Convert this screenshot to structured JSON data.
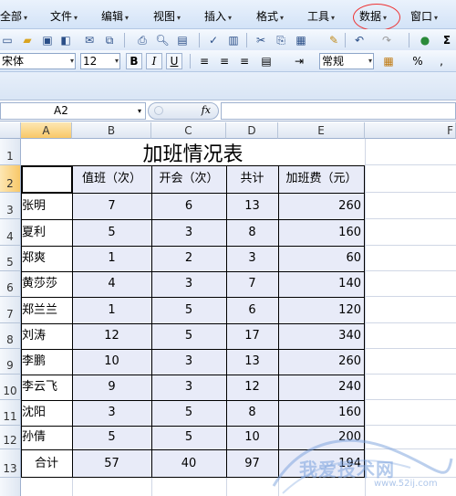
{
  "menu": {
    "items": [
      "全部",
      "文件",
      "编辑",
      "视图",
      "插入",
      "格式",
      "工具",
      "数据",
      "窗口"
    ]
  },
  "toolbar": {
    "font_name": "宋体",
    "font_size": "12",
    "bold_label": "B",
    "italic_label": "I",
    "underline_label": "U",
    "number_format": "常规",
    "percent_label": "%",
    "sigma_label": "Σ"
  },
  "formula_bar": {
    "name_box": "A2",
    "fx_label": "fx",
    "content": ""
  },
  "sheet": {
    "columns": [
      "A",
      "B",
      "C",
      "D",
      "E",
      "F"
    ],
    "rows": [
      "1",
      "2",
      "3",
      "4",
      "5",
      "6",
      "7",
      "8",
      "9",
      "10",
      "11",
      "12",
      "13"
    ],
    "selected_cell": "A2",
    "title": "加班情况表",
    "headers": [
      "",
      "值班（次）",
      "开会（次）",
      "共计",
      "加班费（元）"
    ],
    "data": [
      {
        "name": "张明",
        "duty": "7",
        "meeting": "6",
        "total": "13",
        "pay": "260"
      },
      {
        "name": "夏利",
        "duty": "5",
        "meeting": "3",
        "total": "8",
        "pay": "160"
      },
      {
        "name": "郑爽",
        "duty": "1",
        "meeting": "2",
        "total": "3",
        "pay": "60"
      },
      {
        "name": "黄莎莎",
        "duty": "4",
        "meeting": "3",
        "total": "7",
        "pay": "140"
      },
      {
        "name": "郑兰兰",
        "duty": "1",
        "meeting": "5",
        "total": "6",
        "pay": "120"
      },
      {
        "name": "刘涛",
        "duty": "12",
        "meeting": "5",
        "total": "17",
        "pay": "340"
      },
      {
        "name": "李鹏",
        "duty": "10",
        "meeting": "3",
        "total": "13",
        "pay": "260"
      },
      {
        "name": "李云飞",
        "duty": "9",
        "meeting": "3",
        "total": "12",
        "pay": "240"
      },
      {
        "name": "沈阳",
        "duty": "3",
        "meeting": "5",
        "total": "8",
        "pay": "160"
      },
      {
        "name": "孙倩",
        "duty": "5",
        "meeting": "5",
        "total": "10",
        "pay": "200"
      }
    ],
    "totals": {
      "label": "合计",
      "duty": "57",
      "meeting": "40",
      "total": "97",
      "pay": "194"
    }
  },
  "watermark": {
    "text": "我爱技术网",
    "sub": "www.52ij.com"
  },
  "colors": {
    "table_fill": "#e8ebf8",
    "selected_header": "#f8c868",
    "highlight_ring": "#ee3333"
  }
}
